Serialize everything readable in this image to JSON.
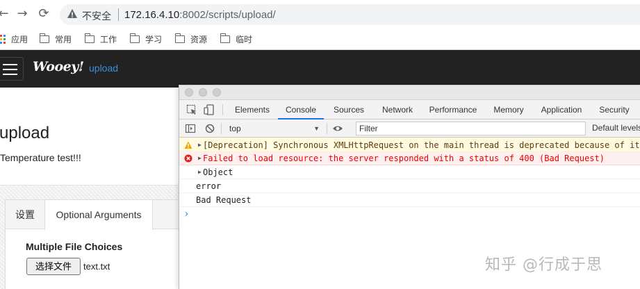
{
  "browser": {
    "back_icon": "←",
    "forward_icon": "→",
    "reload_icon": "⟳",
    "security_label": "不安全",
    "url_host": "172.16.4.10",
    "url_rest": ":8002/scripts/upload/",
    "bookmarks": [
      {
        "label": "应用",
        "icon": "apps-grid-icon"
      },
      {
        "label": "常用",
        "icon": "folder-icon"
      },
      {
        "label": "工作",
        "icon": "folder-icon"
      },
      {
        "label": "学习",
        "icon": "folder-icon"
      },
      {
        "label": "资源",
        "icon": "folder-icon"
      },
      {
        "label": "临时",
        "icon": "folder-icon"
      }
    ]
  },
  "app": {
    "brand": "Wooey!",
    "breadcrumb_sep": "/",
    "breadcrumb_current": "upload",
    "page_title": "upload",
    "page_description": "Temperature test!!!",
    "tabs": [
      {
        "label": "设置"
      },
      {
        "label": "Optional Arguments"
      }
    ],
    "field_label": "Multiple File Choices",
    "file_button_label": "选择文件",
    "file_name": "text.txt"
  },
  "devtools": {
    "tabs": [
      {
        "label": "Elements"
      },
      {
        "label": "Console"
      },
      {
        "label": "Sources"
      },
      {
        "label": "Network"
      },
      {
        "label": "Performance"
      },
      {
        "label": "Memory"
      },
      {
        "label": "Application"
      },
      {
        "label": "Security"
      }
    ],
    "active_tab": "Console",
    "context": "top",
    "filter_placeholder": "Filter",
    "levels_label": "Default levels",
    "messages": [
      {
        "level": "warning",
        "text": "[Deprecation] Synchronous XMLHttpRequest on the main thread is deprecated because of its"
      },
      {
        "level": "error",
        "text": "Failed to load resource: the server responded with a status of 400 (Bad Request)"
      },
      {
        "level": "log",
        "text": "Object"
      },
      {
        "level": "log",
        "text": "error"
      },
      {
        "level": "log",
        "text": "Bad Request"
      }
    ],
    "prompt_symbol": "›"
  },
  "watermark": "知乎 @行成于思",
  "colors": {
    "navbar_bg": "#222222",
    "link_blue": "#3b8ed8",
    "devtools_active_tab": "#1a73e8",
    "error_red": "#e00000",
    "warning_bg": "#fffbe5"
  }
}
